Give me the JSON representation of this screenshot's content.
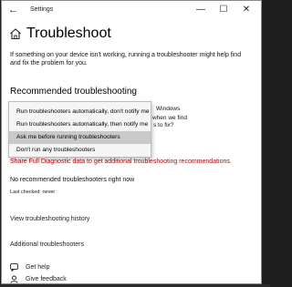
{
  "window": {
    "app_title": "Settings",
    "minimize_glyph": "—",
    "maximize_glyph": "☐",
    "close_glyph": "✕"
  },
  "page": {
    "title": "Troubleshoot",
    "intro": "If something on your device isn't working, running a troubleshooter might help find and fix the problem for you.",
    "section_title": "Recommended troubleshooting"
  },
  "behind_text": {
    "line1": "Windows",
    "line2": "when we find",
    "line3": "s to fix?"
  },
  "dropdown": {
    "options": [
      "Run troubleshooters automatically, don't notify me",
      "Run troubleshooters automatically, then notify me",
      "Ask me before running troubleshooters",
      "Don't run any troubleshooters"
    ],
    "selected_index": 2
  },
  "diagnostic_link": "Share Full Diagnostic data to get additional troubleshooting recommendations.",
  "status": {
    "none_message": "No recommended troubleshooters right now",
    "last_checked": "Last checked: never"
  },
  "links": {
    "view_history": "View troubleshooting history",
    "additional": "Additional troubleshooters",
    "get_help": "Get help",
    "give_feedback": "Give feedback"
  },
  "colors": {
    "accent_red": "#c00000",
    "selected_option_bg": "#c9c9c9"
  },
  "icons": [
    "back-arrow-icon",
    "home-icon",
    "help-icon",
    "feedback-icon"
  ]
}
